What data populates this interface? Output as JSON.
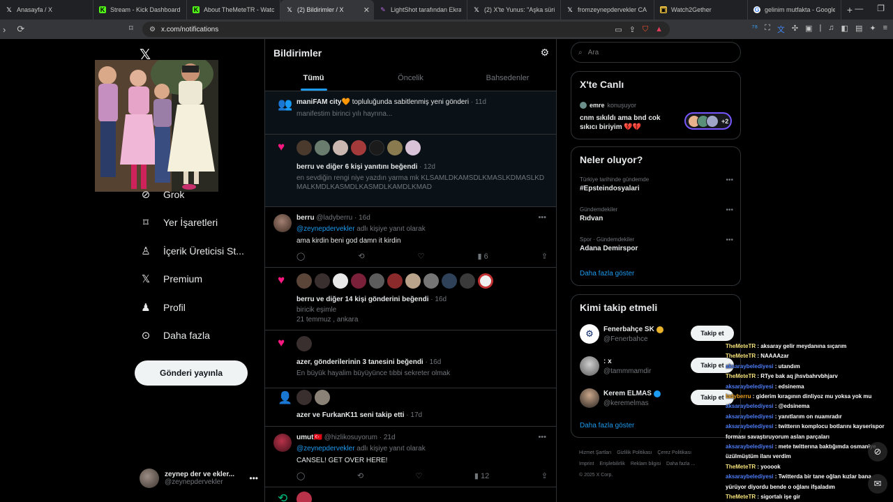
{
  "browser": {
    "tabs": [
      {
        "label": "Anasayfa / X",
        "icon": "x-logo-icon"
      },
      {
        "label": "Stream - Kick Dashboard",
        "icon": "kick-logo-icon"
      },
      {
        "label": "About TheMeteTR - Watch",
        "icon": "kick-logo-icon"
      },
      {
        "label": "(2) Bildirimler / X",
        "icon": "x-logo-icon",
        "active": true
      },
      {
        "label": "LightShot tarafından Ekran",
        "icon": "lightshot-icon"
      },
      {
        "label": "(2) X'te Yunus: \"Aşka sürük",
        "icon": "x-logo-icon"
      },
      {
        "label": "fromzeynepdervekler CA",
        "icon": "x-logo-icon"
      },
      {
        "label": "Watch2Gether",
        "icon": "watch2gether-icon"
      },
      {
        "label": "gelinim mutfakta - Google",
        "icon": "google-icon"
      }
    ],
    "url": "x.com/notifications"
  },
  "nav": {
    "items": [
      {
        "label": "Grok",
        "icon": "grok-icon"
      },
      {
        "label": "Yer İşaretleri",
        "icon": "bookmark-icon"
      },
      {
        "label": "İçerik Üreticisi St...",
        "icon": "creator-studio-icon"
      },
      {
        "label": "Premium",
        "icon": "x-premium-icon"
      },
      {
        "label": "Profil",
        "icon": "profile-icon"
      },
      {
        "label": "Daha fazla",
        "icon": "more-circle-icon"
      }
    ],
    "post_button": "Gönderi yayınla",
    "me": {
      "name": "zeynep der ve ekler...",
      "handle": "@zeynepdervekler"
    }
  },
  "center": {
    "title": "Bildirimler",
    "tabs": [
      "Tümü",
      "Öncelik",
      "Bahsedenler"
    ],
    "notifications": [
      {
        "actor": "maniFAM city",
        "emoji": "🧡",
        "text": " topluluğunda sabitlenmiş yeni gönderi",
        "time": " · 11d",
        "sub": "manifestim birinci yılı hayrına..."
      },
      {
        "actor": "berru",
        "text": " ve diğer 6 kişi yanıtını beğendi",
        "time": " · 12d",
        "sub": "en sevdiğin rengi niye yazdın yarma mk KLSAMLDKAMSDLKMASLKDMASLKDMALKMDLKASMDLKASMDLKAMDLKMAD",
        "avatar_count": 7
      },
      {
        "name": "berru",
        "handle": "@ladyberru",
        "time": "· 16d",
        "reply_to": "@zeynepdervekler",
        "reply_suffix": " adlı kişiye yanıt olarak",
        "text": "ama kirdin beni god damn it kirdin",
        "views": "6"
      },
      {
        "actor": "berru",
        "text": " ve diğer 14 kişi gönderini beğendi",
        "time": " · 16d",
        "sub1": "biricik eşimle",
        "sub2": "21 temmuz , ankara",
        "avatar_count": 11
      },
      {
        "actor": "azer",
        "text": ", gönderilerinin 3 tanesini beğendi",
        "time": " · 16d",
        "sub": "En büyük hayalim büyüyünce tıbbi sekreter olmak"
      },
      {
        "actor": "azer",
        "mid": " ve ",
        "actor2": "FurkanK11",
        "text": " seni takip etti",
        "time": " · 17d"
      },
      {
        "name": "umut",
        "flag": "🇹🇷",
        "handle": "@hizlikosuyorum",
        "time": "· 21d",
        "reply_to": "@zeynepdervekler",
        "reply_suffix": " adlı kişiye yanıt olarak",
        "text": "CANSEL! GET OVER HERE!",
        "views": "12"
      }
    ]
  },
  "right": {
    "search_placeholder": "Ara",
    "live": {
      "title": "X'te Canlı",
      "host": "emre",
      "host_suffix": " konuşuyor",
      "space_title": "cnm sıkıldı ama bnd cok sıkıcı biriyim 💔💔",
      "extra": "+2"
    },
    "trends": {
      "title": "Neler oluyor?",
      "items": [
        {
          "context": "Türkiye tarihinde gündemde",
          "topic": "#Epsteindosyalari"
        },
        {
          "context": "Gündemdekiler",
          "topic": "Rıdvan"
        },
        {
          "context": "Spor · Gündemdekiler",
          "topic": "Adana Demirspor"
        }
      ],
      "show_more": "Daha fazla göster"
    },
    "follow": {
      "title": "Kimi takip etmeli",
      "items": [
        {
          "name": "Fenerbahçe SK",
          "handle": "@Fenerbahce",
          "verified_color": "#e8b32a",
          "button": "Takip et"
        },
        {
          "name": ": x",
          "handle": "@tammmamdir",
          "button": "Takip et"
        },
        {
          "name": "Kerem ELMAS",
          "handle": "@keremelmas",
          "verified_color": "#1d9bf0",
          "button": "Takip et"
        }
      ],
      "show_more": "Daha fazla göster"
    },
    "footer": [
      "Hizmet Şartları",
      "Gizlilik Politikası",
      "Çerez Politikası",
      "Imprint",
      "Erişilebilirlik",
      "Reklam bilgisi",
      "Daha fazla ...",
      "© 2025 X Corp."
    ]
  },
  "chat": [
    {
      "user": "TheMeteTR",
      "msg": " : aksaray gelir meydanına sıçarım",
      "color": "u1"
    },
    {
      "user": "TheMeteTR",
      "msg": " : NAAAAzar",
      "color": "u1"
    },
    {
      "user": "aksaraybelediyesi",
      "msg": " : utandım",
      "color": "u2"
    },
    {
      "user": "TheMeteTR",
      "msg": " : RTye bak aq jhsvbahrvbhjarv",
      "color": "u1"
    },
    {
      "user": "aksaraybelediyesi",
      "msg": " : edsinema",
      "color": "u2"
    },
    {
      "user": "ladyberru",
      "msg": " : giderim kıragının dinliyoz mu yoksa yok mu",
      "color": "u3"
    },
    {
      "user": "aksaraybelediyesi",
      "msg": " : @edsinema",
      "color": "u2"
    },
    {
      "user": "aksaraybelediyesi",
      "msg": " : yanıtlarım on nuamradır",
      "color": "u2"
    },
    {
      "user": "aksaraybelediyesi",
      "msg": " : twitterın komplocu botlarını kayserispor forması savaştıruyorum aslan parçaları",
      "color": "u2",
      "wrap": true
    },
    {
      "user": "aksaraybelediyesi",
      "msg": " : mete twitterına baktığımda osmaniye üzülmüştüm ilanı verdim",
      "color": "u2",
      "wrap": true
    },
    {
      "user": "TheMeteTR",
      "msg": " : yooook",
      "color": "u1"
    },
    {
      "user": "aksaraybelediyesi",
      "msg": " : Twitterda bir tane oğlan kızlar bana yürüyor diyordu bende o oğlanı ifşaladım",
      "color": "u2",
      "wrap": true
    },
    {
      "user": "TheMeteTR",
      "msg": " : sigortalı işe gir",
      "color": "u1"
    }
  ]
}
